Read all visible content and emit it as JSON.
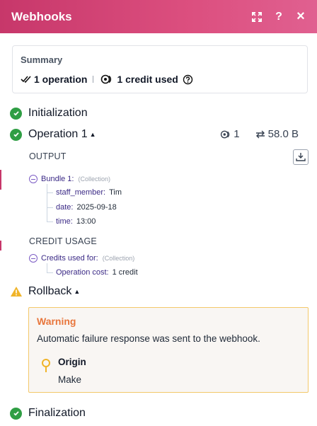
{
  "header": {
    "title": "Webhooks",
    "buttons": {
      "expand": "expand-icon",
      "help": "?",
      "close": "×"
    }
  },
  "summary": {
    "title": "Summary",
    "operations": "1 operation",
    "credits": "1 credit used"
  },
  "steps": {
    "initialization": "Initialization",
    "operation": "Operation 1",
    "rollback": "Rollback",
    "finalization": "Finalization"
  },
  "operation": {
    "ops_count": "1",
    "data_size": "58.0 B",
    "output_heading": "OUTPUT",
    "credit_heading": "CREDIT USAGE"
  },
  "bundle": {
    "label": "Bundle 1:",
    "type": "(Collection)",
    "fields": [
      {
        "key": "staff_member:",
        "value": "Tim"
      },
      {
        "key": "date:",
        "value": "2025-09-18"
      },
      {
        "key": "time:",
        "value": "13:00"
      }
    ]
  },
  "credit_usage": {
    "label": "Credits used for:",
    "type": "(Collection)",
    "fields": [
      {
        "key": "Operation cost:",
        "value": "1 credit"
      }
    ]
  },
  "warning": {
    "title": "Warning",
    "message": "Automatic failure response was sent to the webhook.",
    "origin_label": "Origin",
    "origin_value": "Make"
  },
  "colors": {
    "header": "#d2436f",
    "success": "#2f9e44",
    "warning": "#f0b429",
    "warning_title": "#e8763c",
    "tree_key": "#3b2a86"
  }
}
